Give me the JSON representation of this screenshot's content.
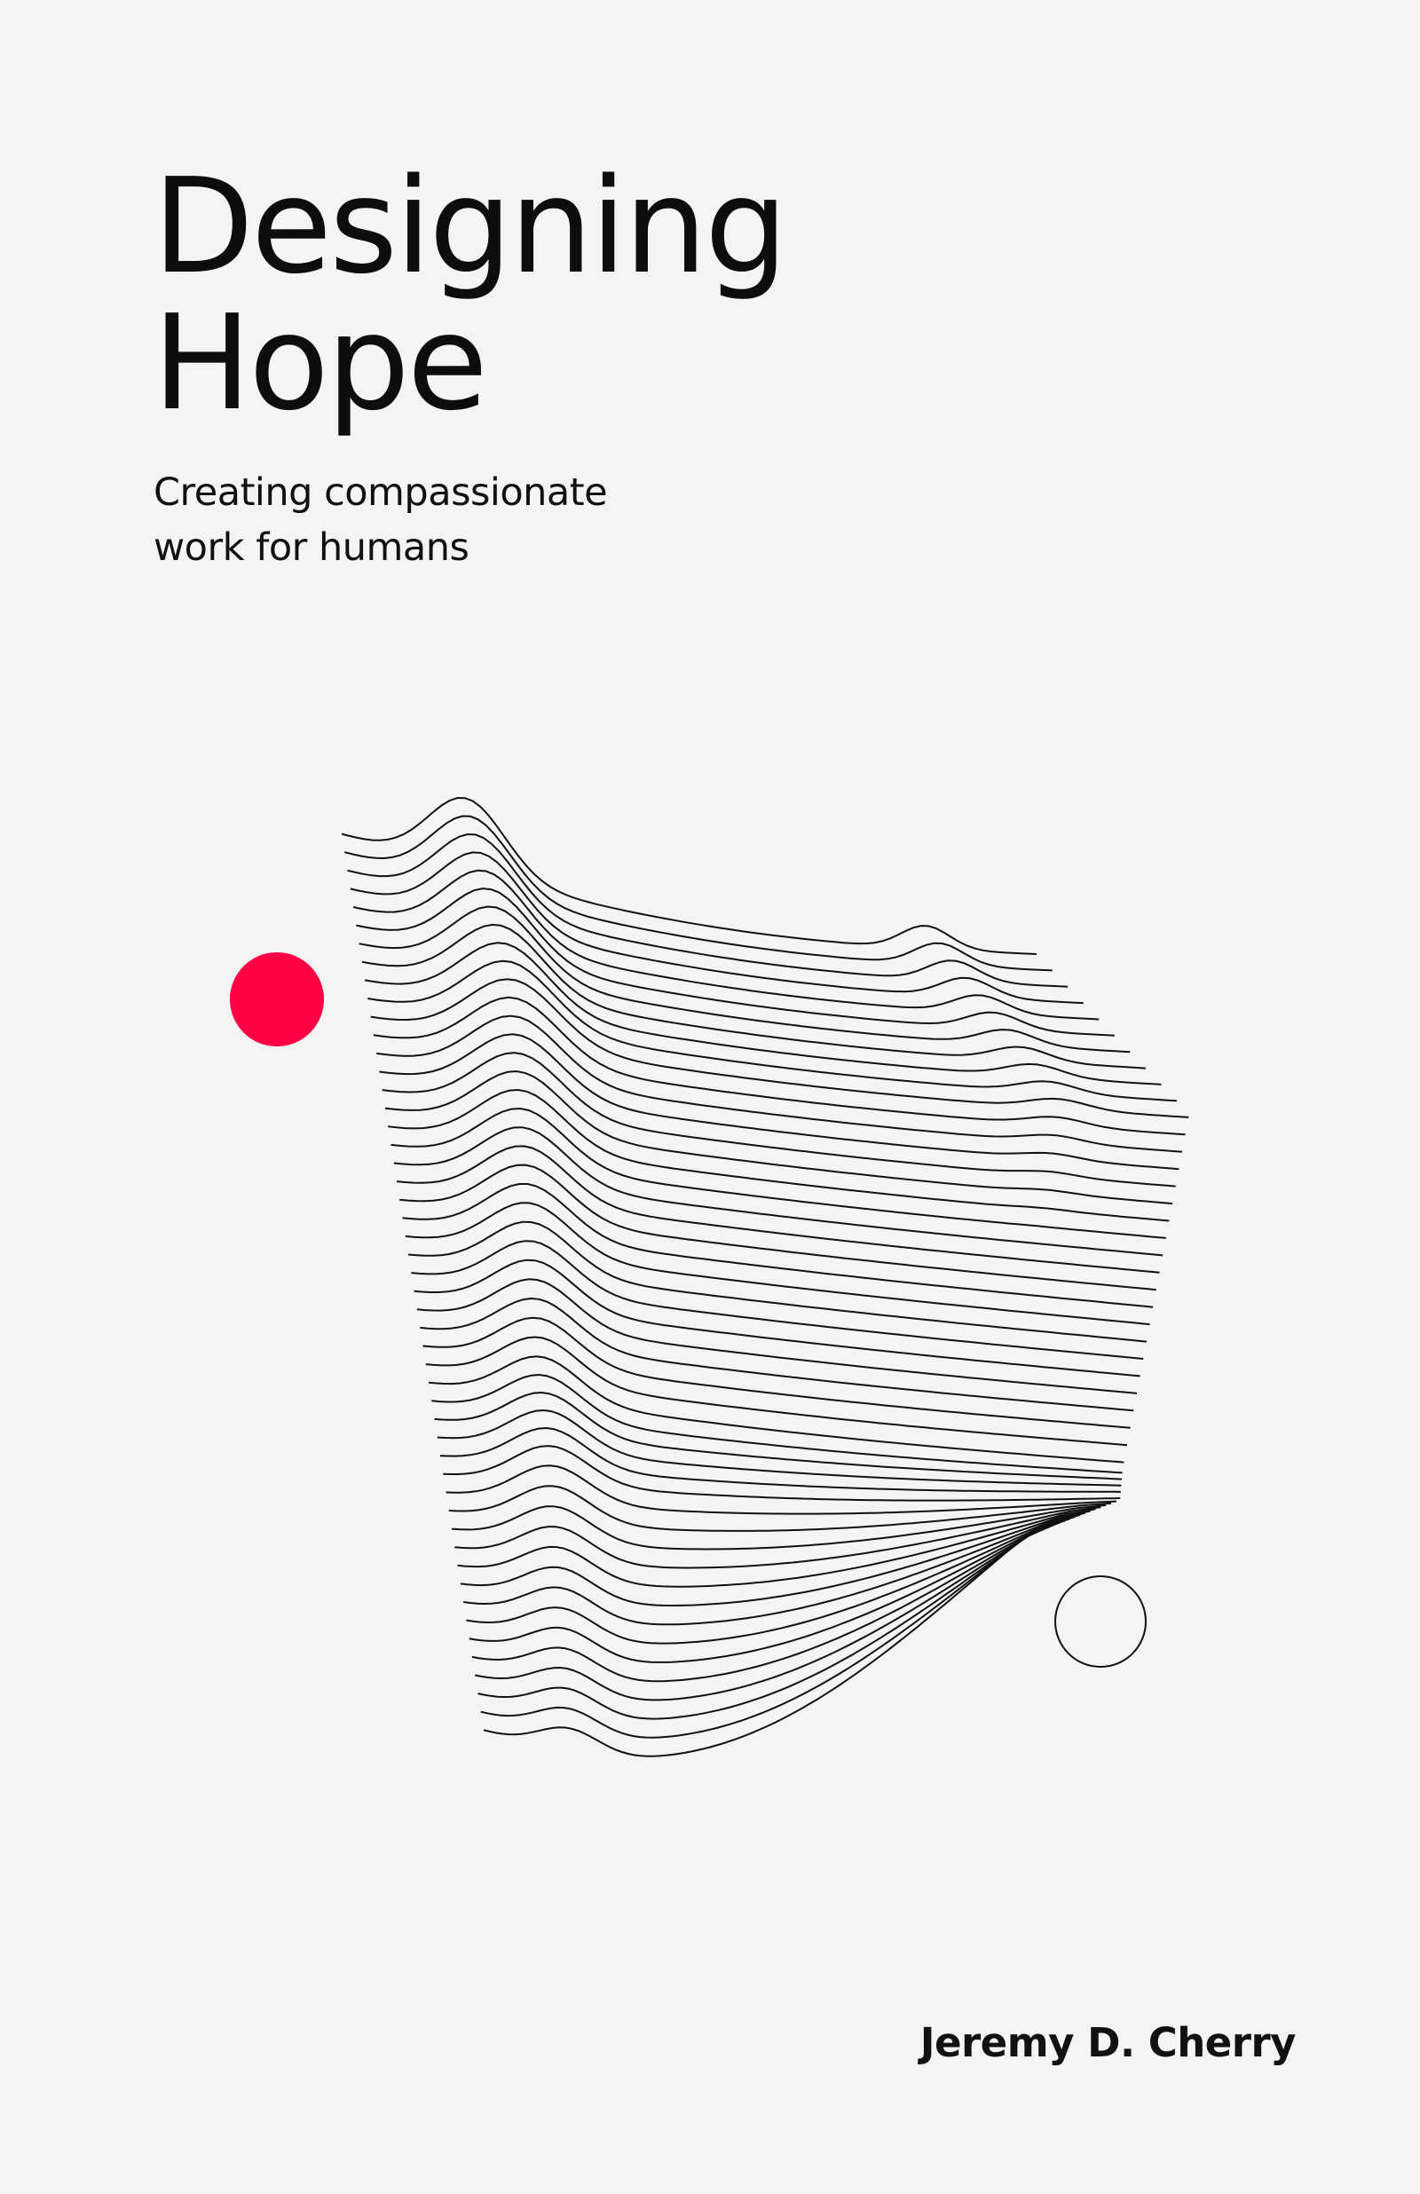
{
  "cover": {
    "title_line1": "Designing",
    "title_line2": "Hope",
    "subtitle_line1": "Creating compassionate",
    "subtitle_line2": "work for humans",
    "author": "Jeremy D. Cherry"
  },
  "colors": {
    "background": "#f4f4f2",
    "text": "#111111",
    "accent": "#ff0044",
    "lines": "#111111"
  }
}
